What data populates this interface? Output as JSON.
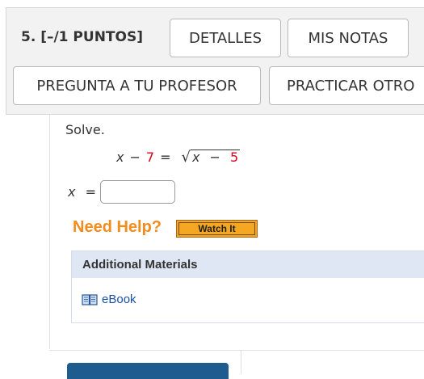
{
  "question": {
    "label": "5.  [–/1 PUNTOS]"
  },
  "buttons": {
    "details": "DETALLES",
    "notes": "MIS NOTAS",
    "ask_teacher": "PREGUNTA A TU PROFESOR",
    "practice": "PRACTICAR OTRO"
  },
  "problem": {
    "instruction": "Solve.",
    "lhs_var": "x",
    "lhs_minus": "−",
    "lhs_const": "7",
    "equals": "=",
    "rad_var": "x",
    "rad_minus": "−",
    "rad_const": "5"
  },
  "answer": {
    "label_var": "x",
    "label_eq": "=",
    "value": ""
  },
  "help": {
    "title": "Need Help?",
    "watch": "Watch It"
  },
  "materials": {
    "title": "Additional Materials",
    "ebook": "eBook"
  },
  "colors": {
    "accent_orange": "#f28c1d",
    "number_red": "#d0021b",
    "link_blue": "#1a4fa8",
    "submit_blue": "#1e5b8f"
  }
}
